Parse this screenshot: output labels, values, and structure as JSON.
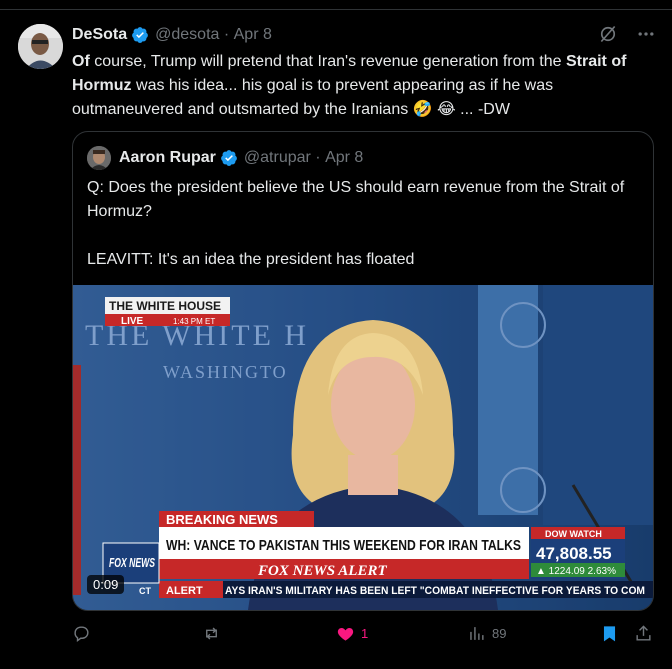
{
  "author": {
    "display_name": "DeSota",
    "handle": "@desota",
    "date": "Apr 8"
  },
  "tweet": {
    "text_lead_bold": "Of",
    "text_part1": " course, Trump will pretend that Iran's revenue generation from the ",
    "text_bold2": "Strait of Hormuz",
    "text_part2": " was his idea... his goal is to prevent appearing as if he was outmaneuvered and outsmarted by the Iranians 🤣 😂 ...  -DW"
  },
  "quoted": {
    "display_name": "Aaron Rupar",
    "handle": "@atrupar",
    "date": "Apr 8",
    "paragraph1": "Q: Does the president believe the US should earn revenue from the Strait of Hormuz?",
    "paragraph2": "LEAVITT: It's an idea the president has floated",
    "video": {
      "duration": "0:09",
      "bug_title": "THE WHITE HOUSE",
      "bug_live": "LIVE",
      "bug_time": "1:43 PM ET",
      "podium_text1": "THE WHITE H",
      "podium_text2": "WASHINGTO",
      "breaking": "BREAKING NEWS",
      "headline": "WH: VANCE TO PAKISTAN THIS WEEKEND FOR IRAN TALKS",
      "alert": "FOX NEWS ALERT",
      "ticker_label": "ALERT",
      "ticker_text": "AYS IRAN'S MILITARY HAS BEEN LEFT \"COMBAT INEFFECTIVE FOR YEARS TO COM",
      "dow_label": "DOW WATCH",
      "dow_value": "47,808.55",
      "dow_change": "▲ 1224.09 2.63%",
      "fox_logo": "FOX NEWS",
      "ct_label": "CT"
    }
  },
  "actions": {
    "likes": "1",
    "views": "89"
  },
  "colors": {
    "accent_blue": "#1d9bf0",
    "like_pink": "#f91880"
  }
}
